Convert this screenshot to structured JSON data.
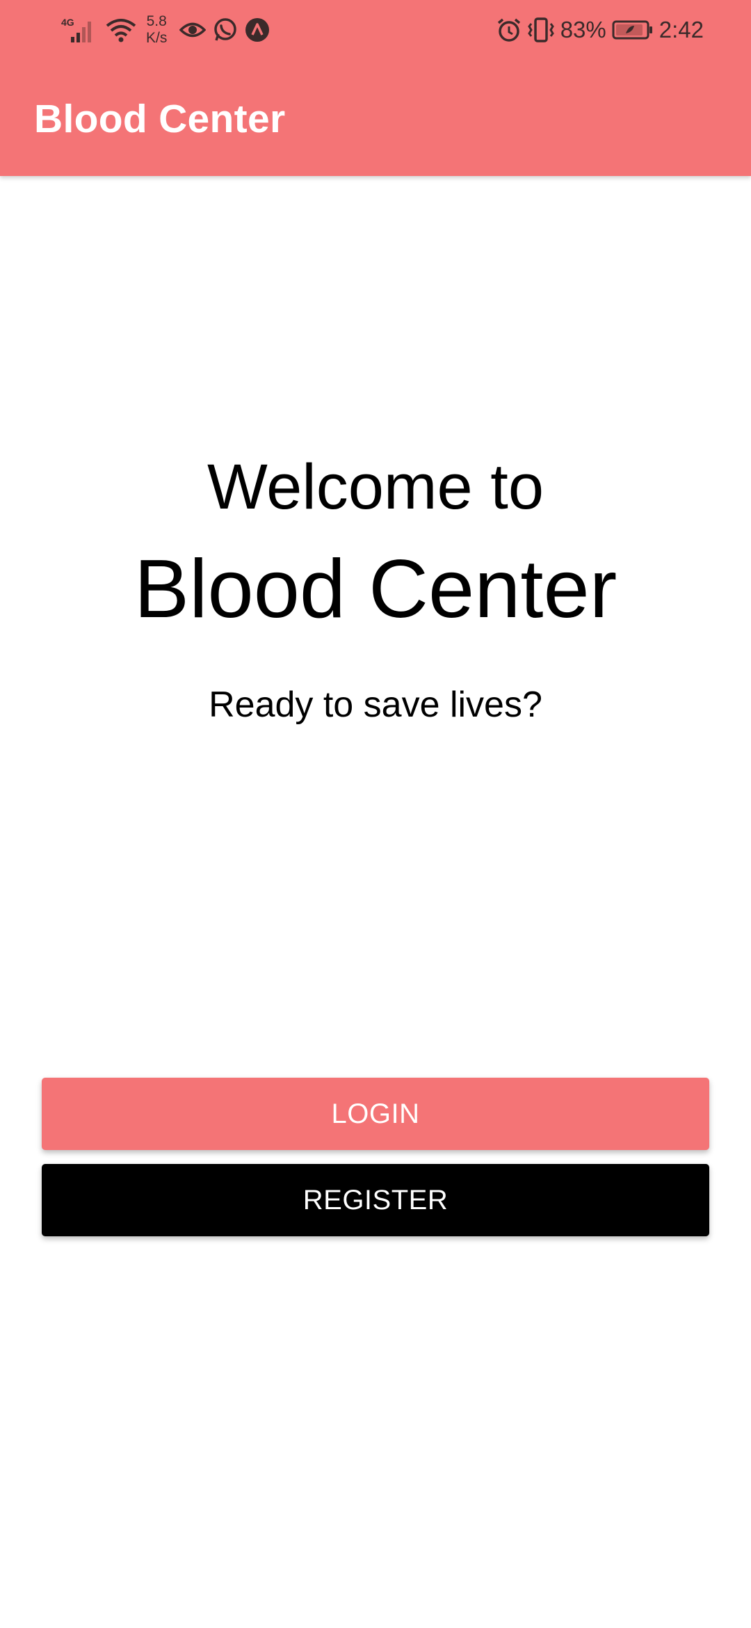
{
  "status_bar": {
    "network_type": "4G",
    "net_speed_value": "5.8",
    "net_speed_unit": "K/s",
    "battery_percent": "83%",
    "time": "2:42",
    "icons": [
      "signal-icon",
      "wifi-icon",
      "eye-icon",
      "whatsapp-icon",
      "app-notification-icon",
      "alarm-icon",
      "vibrate-icon",
      "battery-icon"
    ]
  },
  "app_bar": {
    "title": "Blood Center"
  },
  "welcome": {
    "line1": "Welcome to",
    "line2": "Blood Center",
    "tagline": "Ready to save lives?"
  },
  "buttons": {
    "login_label": "LOGIN",
    "register_label": "REGISTER"
  },
  "colors": {
    "primary": "#f47476",
    "register_button": "#000000",
    "background": "#ffffff",
    "title_text": "#ffffff"
  }
}
